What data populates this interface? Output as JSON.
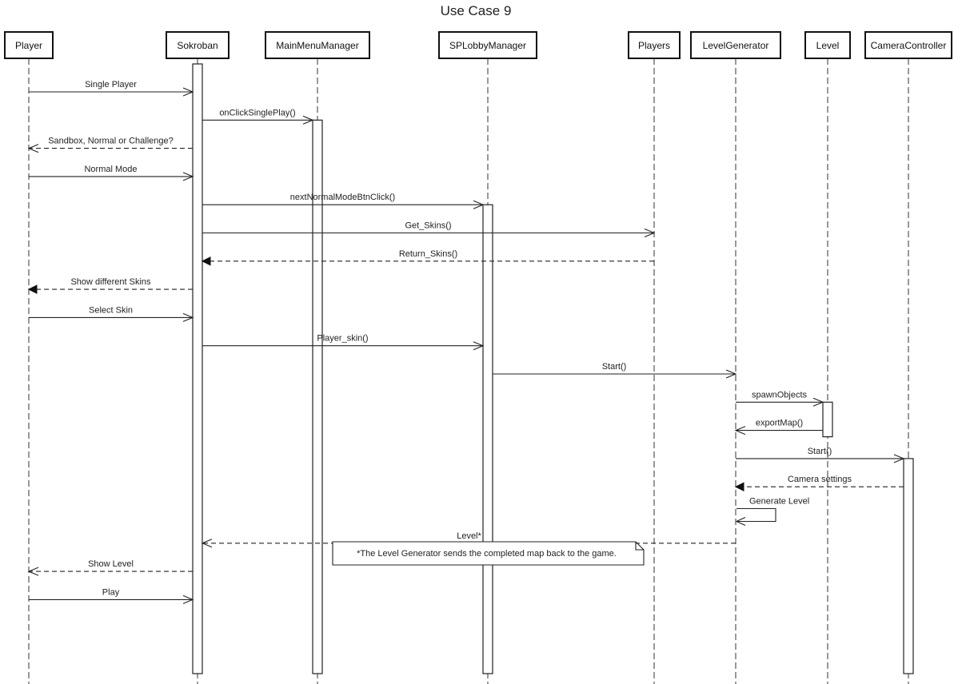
{
  "title": "Use Case 9",
  "actors": [
    {
      "id": "player",
      "label": "Player"
    },
    {
      "id": "sokroban",
      "label": "Sokroban"
    },
    {
      "id": "mainmenu",
      "label": "MainMenuManager"
    },
    {
      "id": "splobby",
      "label": "SPLobbyManager"
    },
    {
      "id": "players",
      "label": "Players"
    },
    {
      "id": "levelgen",
      "label": "LevelGenerator"
    },
    {
      "id": "level",
      "label": "Level"
    },
    {
      "id": "camera",
      "label": "CameraController"
    }
  ],
  "activations": [
    {
      "actor": "sokroban",
      "from_step": 0,
      "to_step": "end"
    },
    {
      "actor": "mainmenu",
      "from_step": 1,
      "to_step": "end"
    },
    {
      "actor": "splobby",
      "from_step": 4,
      "to_step": "end"
    },
    {
      "actor": "level",
      "from_step": 11,
      "to_step": 12
    },
    {
      "actor": "camera",
      "from_step": 13,
      "to_step": "end"
    }
  ],
  "messages": [
    {
      "from": "player",
      "to": "sokroban",
      "label": "Single Player",
      "style": "solid",
      "head": "open"
    },
    {
      "from": "sokroban",
      "to": "mainmenu",
      "label": "onClickSinglePlay()",
      "style": "solid",
      "head": "open"
    },
    {
      "from": "sokroban",
      "to": "player",
      "label": "Sandbox, Normal or Challenge?",
      "style": "dashed",
      "head": "open"
    },
    {
      "from": "player",
      "to": "sokroban",
      "label": "Normal Mode",
      "style": "solid",
      "head": "open"
    },
    {
      "from": "sokroban",
      "to": "splobby",
      "label": "nextNormalModeBtnClick()",
      "style": "solid",
      "head": "open"
    },
    {
      "from": "sokroban",
      "to": "players",
      "label": "Get_Skins()",
      "style": "solid",
      "head": "open"
    },
    {
      "from": "players",
      "to": "sokroban",
      "label": "Return_Skins()",
      "style": "dashed",
      "head": "filled"
    },
    {
      "from": "sokroban",
      "to": "player",
      "label": "Show different Skins",
      "style": "dashed",
      "head": "filled"
    },
    {
      "from": "player",
      "to": "sokroban",
      "label": "Select Skin",
      "style": "solid",
      "head": "open"
    },
    {
      "from": "sokroban",
      "to": "splobby",
      "label": "Player_skin()",
      "style": "solid",
      "head": "open"
    },
    {
      "from": "splobby",
      "to": "levelgen",
      "label": "Start()",
      "style": "solid",
      "head": "open"
    },
    {
      "from": "levelgen",
      "to": "level",
      "label": "spawnObjects",
      "style": "solid",
      "head": "open"
    },
    {
      "from": "level",
      "to": "levelgen",
      "label": "exportMap()",
      "style": "solid",
      "head": "open"
    },
    {
      "from": "levelgen",
      "to": "camera",
      "label": "Start()",
      "style": "solid",
      "head": "open"
    },
    {
      "from": "camera",
      "to": "levelgen",
      "label": "Camera settings",
      "style": "dashed",
      "head": "filled"
    },
    {
      "from": "levelgen",
      "to": "levelgen",
      "label": "Generate Level",
      "style": "solid",
      "head": "open",
      "self": true
    },
    {
      "from": "levelgen",
      "to": "sokroban",
      "label": "Level*",
      "style": "dashed",
      "head": "open"
    },
    {
      "from": "sokroban",
      "to": "player",
      "label": "Show Level",
      "style": "dashed",
      "head": "open"
    },
    {
      "from": "player",
      "to": "sokroban",
      "label": "Play",
      "style": "solid",
      "head": "open"
    }
  ],
  "note": {
    "text": "*The Level Generator sends the completed map back to the game.",
    "after_step": 15
  }
}
